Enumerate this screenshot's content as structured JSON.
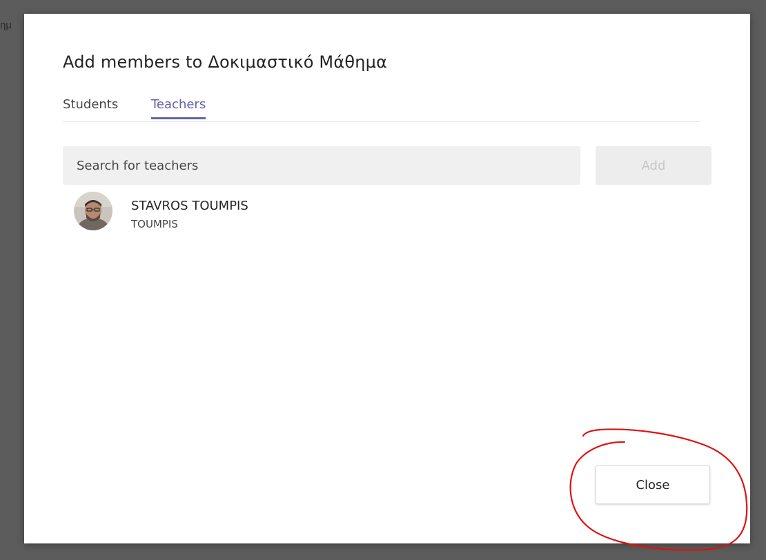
{
  "background": {
    "partial_text": "ημ"
  },
  "dialog": {
    "title": "Add members to Δοκιμαστικό Μάθημα",
    "tabs": [
      {
        "label": "Students",
        "selected": false
      },
      {
        "label": "Teachers",
        "selected": true
      }
    ],
    "search": {
      "placeholder": "Search for teachers",
      "value": ""
    },
    "add_label": "Add",
    "results": [
      {
        "name": "STAVROS TOUMPIS",
        "subtitle": "TOUMPIS",
        "avatar_icon": "user-photo"
      }
    ],
    "close_label": "Close"
  },
  "colors": {
    "accent": "#6264a7",
    "annotation": "#e01010",
    "overlay": "#5c5c5c"
  }
}
